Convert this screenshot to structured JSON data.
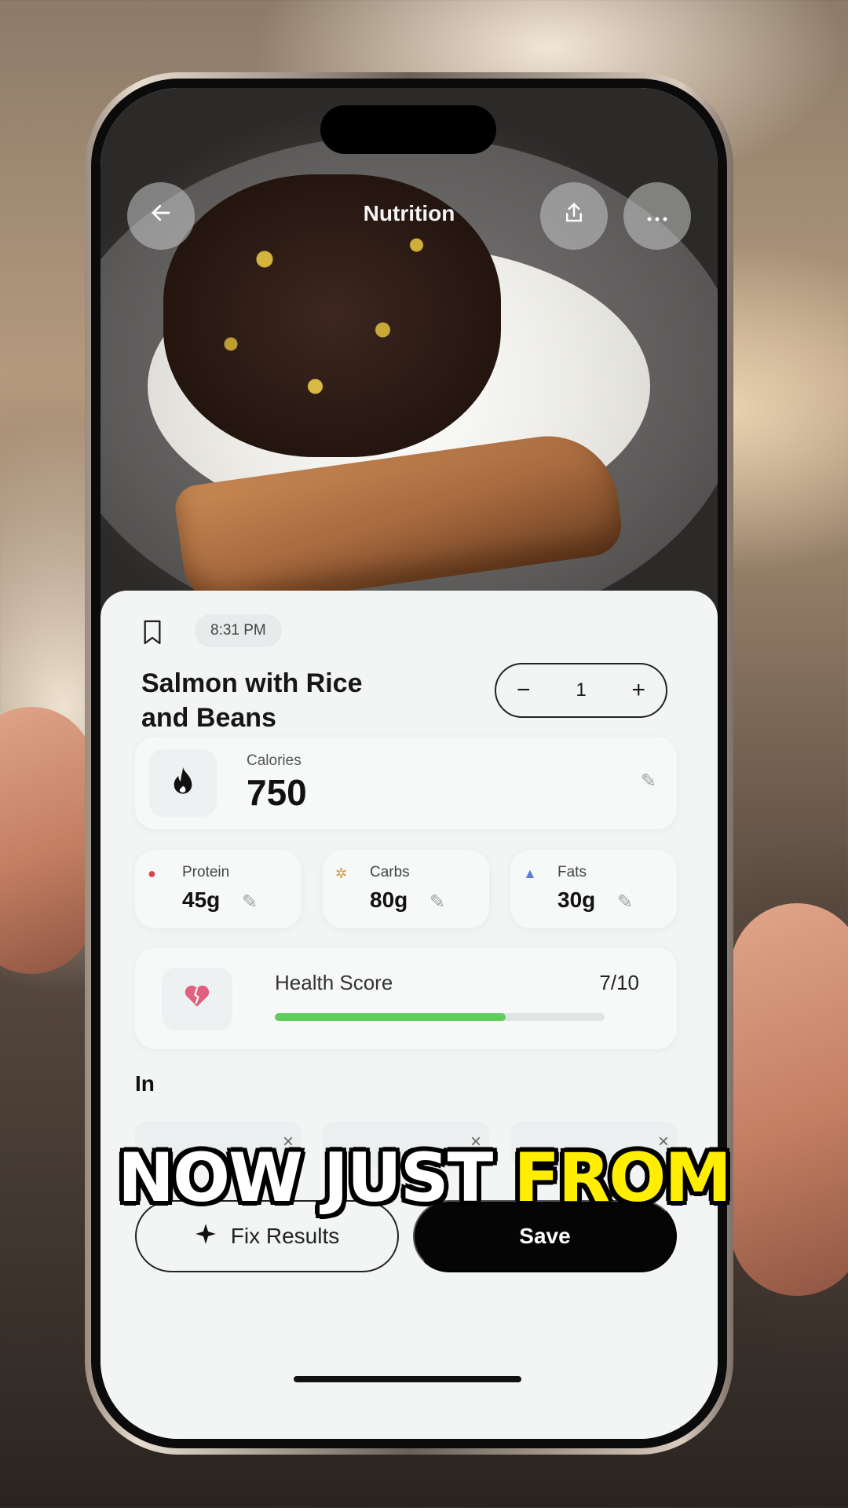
{
  "nav": {
    "title": "Nutrition",
    "back_icon": "arrow-left-icon",
    "share_icon": "share-icon",
    "more_icon": "more-icon"
  },
  "meal": {
    "time": "8:31 PM",
    "title": "Salmon with Rice and Beans",
    "servings": "1"
  },
  "stepper": {
    "minus": "−",
    "plus": "+"
  },
  "calories": {
    "label": "Calories",
    "value": "750",
    "icon": "flame-icon"
  },
  "macros": [
    {
      "label": "Protein",
      "value": "45g",
      "icon": "drumstick-icon",
      "color": "#d8434e"
    },
    {
      "label": "Carbs",
      "value": "80g",
      "icon": "wheat-icon",
      "color": "#d49a3a"
    },
    {
      "label": "Fats",
      "value": "30g",
      "icon": "droplet-icon",
      "color": "#5b7fd6"
    }
  ],
  "health": {
    "label": "Health Score",
    "score": "7/10",
    "fraction": 0.7,
    "icon": "broken-heart-icon",
    "bar_color": "#5fce5a"
  },
  "ingredients": {
    "title": "In",
    "chips": [
      {
        "remove": "×"
      },
      {
        "remove": "×"
      },
      {
        "remove": "×"
      }
    ]
  },
  "actions": {
    "fix_label": "Fix Results",
    "fix_icon": "sparkle-icon",
    "save_label": "Save"
  },
  "caption": {
    "part1": "NOW JUST ",
    "part2": "FROM",
    "highlight_color": "#ffee00"
  }
}
